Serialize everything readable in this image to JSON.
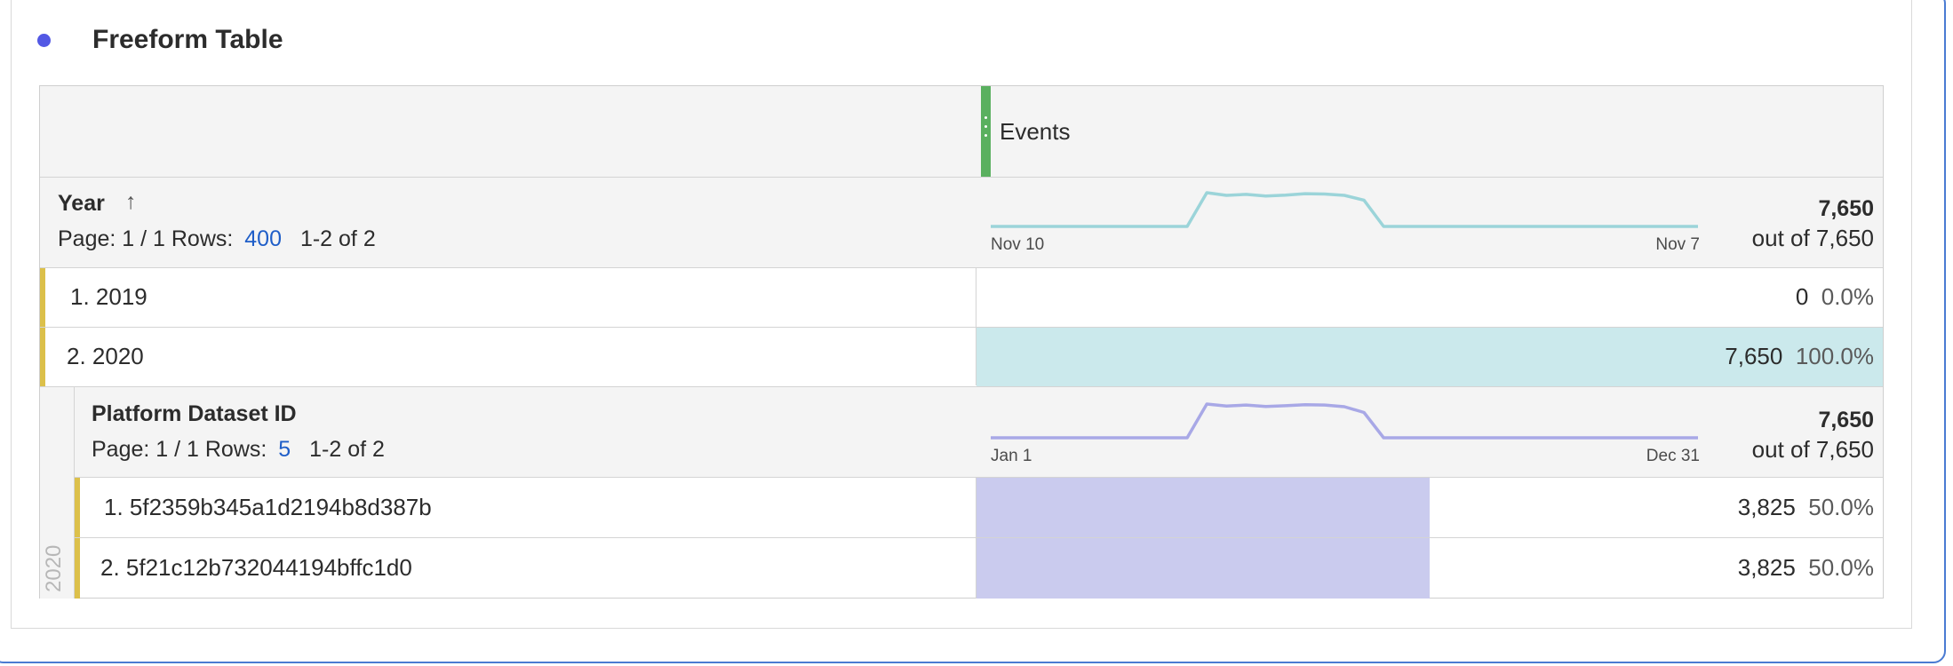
{
  "panel": {
    "title": "Freeform Table"
  },
  "table": {
    "metric_header": "Events",
    "dimension1": {
      "label": "Year",
      "sort_icon": "arrow-up-icon",
      "page_label": "Page: 1 / 1  Rows:",
      "rows_value": "400",
      "range": "1-2 of 2",
      "spark_start": "Nov 10",
      "spark_end": "Nov 7",
      "total": "7,650",
      "total_sub": "out of 7,650",
      "sparkline": [
        0,
        0,
        0,
        0,
        0,
        0,
        0,
        0,
        0,
        0,
        0,
        1.0,
        0.92,
        0.95,
        0.9,
        0.93,
        0.97,
        0.96,
        0.92,
        0.78,
        0,
        0,
        0,
        0,
        0,
        0,
        0,
        0,
        0,
        0,
        0,
        0,
        0,
        0,
        0,
        0,
        0
      ],
      "color": "#9bd4d9",
      "rows": [
        {
          "label": "1. 2019",
          "value": "0",
          "percent": "0.0%",
          "fraction": 0
        },
        {
          "label": "2. 2020",
          "value": "7,650",
          "percent": "100.0%",
          "fraction": 1.0
        }
      ]
    },
    "dimension2": {
      "parent_label": "2020",
      "label": "Platform Dataset ID",
      "page_label": "Page: 1 / 1  Rows:",
      "rows_value": "5",
      "range": "1-2 of 2",
      "spark_start": "Jan 1",
      "spark_end": "Dec 31",
      "total": "7,650",
      "total_sub": "out of 7,650",
      "sparkline": [
        0,
        0,
        0,
        0,
        0,
        0,
        0,
        0,
        0,
        0,
        0,
        1.0,
        0.94,
        0.97,
        0.93,
        0.95,
        0.98,
        0.97,
        0.92,
        0.75,
        0,
        0,
        0,
        0,
        0,
        0,
        0,
        0,
        0,
        0,
        0,
        0,
        0,
        0,
        0,
        0,
        0
      ],
      "color": "#a8a8e6",
      "rows": [
        {
          "label": "1. 5f2359b345a1d2194b8d387b",
          "value": "3,825",
          "percent": "50.0%",
          "fraction": 0.5
        },
        {
          "label": "2. 5f21c12b732044194bffc1d0",
          "value": "3,825",
          "percent": "50.0%",
          "fraction": 0.5
        }
      ]
    }
  }
}
